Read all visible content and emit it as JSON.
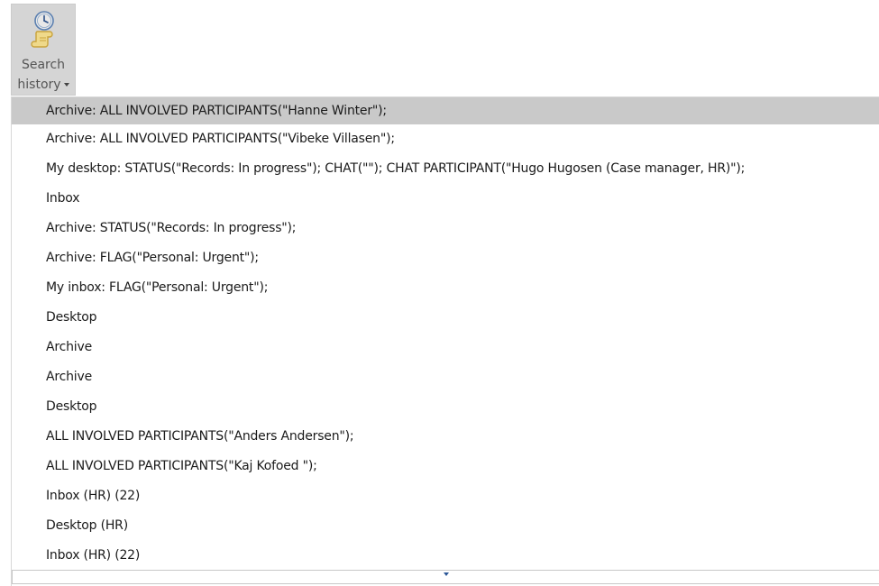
{
  "ribbon": {
    "search_history_button": {
      "label_line1": "Search",
      "label_line2": "history",
      "icon": "clock-scroll-icon"
    }
  },
  "history": {
    "items": [
      {
        "label": "Archive: ALL INVOLVED PARTICIPANTS(\"Hanne Winter\");",
        "selected": true
      },
      {
        "label": "Archive: ALL INVOLVED PARTICIPANTS(\"Vibeke Villasen\");",
        "selected": false
      },
      {
        "label": "My desktop: STATUS(\"Records: In progress\"); CHAT(\"\"); CHAT PARTICIPANT(\"Hugo Hugosen (Case manager, HR)\");",
        "selected": false
      },
      {
        "label": "Inbox",
        "selected": false
      },
      {
        "label": "Archive: STATUS(\"Records: In progress\");",
        "selected": false
      },
      {
        "label": "Archive: FLAG(\"Personal: Urgent\");",
        "selected": false
      },
      {
        "label": "My inbox: FLAG(\"Personal: Urgent\");",
        "selected": false
      },
      {
        "label": "Desktop",
        "selected": false
      },
      {
        "label": "Archive",
        "selected": false
      },
      {
        "label": "Archive",
        "selected": false
      },
      {
        "label": "Desktop",
        "selected": false
      },
      {
        "label": "ALL INVOLVED PARTICIPANTS(\"Anders Andersen\");",
        "selected": false
      },
      {
        "label": "ALL INVOLVED PARTICIPANTS(\"Kaj Kofoed \");",
        "selected": false
      },
      {
        "label": "Inbox (HR) (22)",
        "selected": false
      },
      {
        "label": "Desktop (HR)",
        "selected": false
      },
      {
        "label": "Inbox (HR) (22)",
        "selected": false
      }
    ]
  },
  "colors": {
    "selected_row": "#c9c9c9",
    "ribbon_button_bg": "#d5d5d5",
    "icon_color": "#c9a33c",
    "scroll_arrow": "#2b5797"
  }
}
